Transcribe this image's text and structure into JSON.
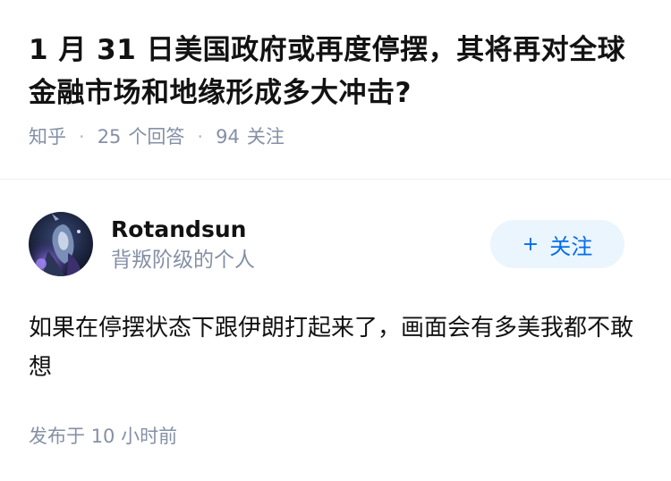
{
  "question": {
    "title": "1 月 31 日美国政府或再度停摆，其将再对全球金融市场和地缘形成多大冲击?",
    "source": "知乎",
    "answers_count": "25",
    "answers_label": "个回答",
    "followers_count": "94",
    "followers_label": "关注"
  },
  "answer": {
    "author_name": "Rotandsun",
    "author_bio": "背叛阶级的个人",
    "follow_label": "关注",
    "follow_icon": "plus-icon",
    "content": "如果在停摆状态下跟伊朗打起来了，画面会有多美我都不敢想",
    "time_prefix": "发布于",
    "time_value": "10 小时前"
  },
  "colors": {
    "accent": "#056de8",
    "follow_bg": "#ebf5fd",
    "meta_text": "#8590a6",
    "main_text": "#121212"
  }
}
